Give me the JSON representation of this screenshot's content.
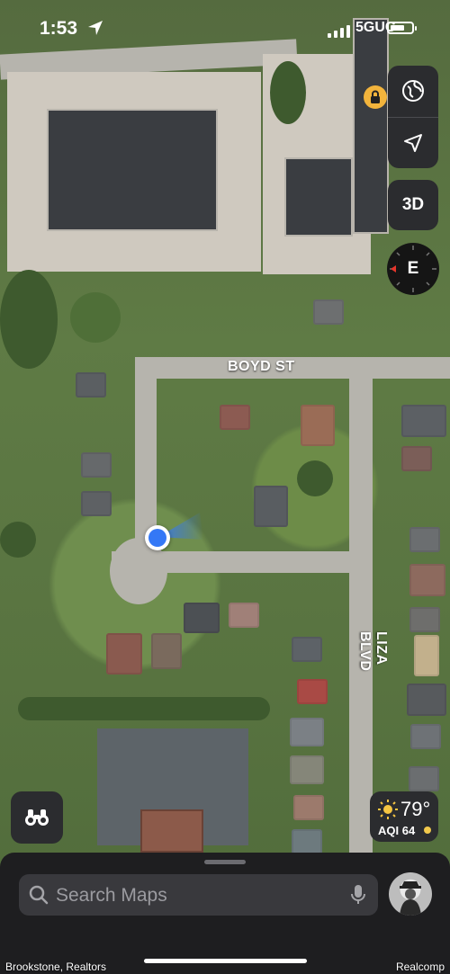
{
  "status_bar": {
    "time": "1:53",
    "network": "5GUC",
    "battery_percent": 70
  },
  "map": {
    "streets": [
      "BOYD ST",
      "LIZA BLVD"
    ],
    "user_heading": "east"
  },
  "map_controls": {
    "globe": "globe-icon",
    "location": "location-arrow-icon",
    "view_3d_label": "3D",
    "compass_label": "E"
  },
  "weather": {
    "temperature": "79°",
    "aqi": "AQI 64"
  },
  "search": {
    "placeholder": "Search Maps"
  },
  "watermarks": {
    "left": "Brookstone, Realtors",
    "right": "Realcomp"
  },
  "colors": {
    "user_dot": "#3478f6",
    "panel": "#2b2c2f",
    "sheet": "#1e1e20"
  }
}
